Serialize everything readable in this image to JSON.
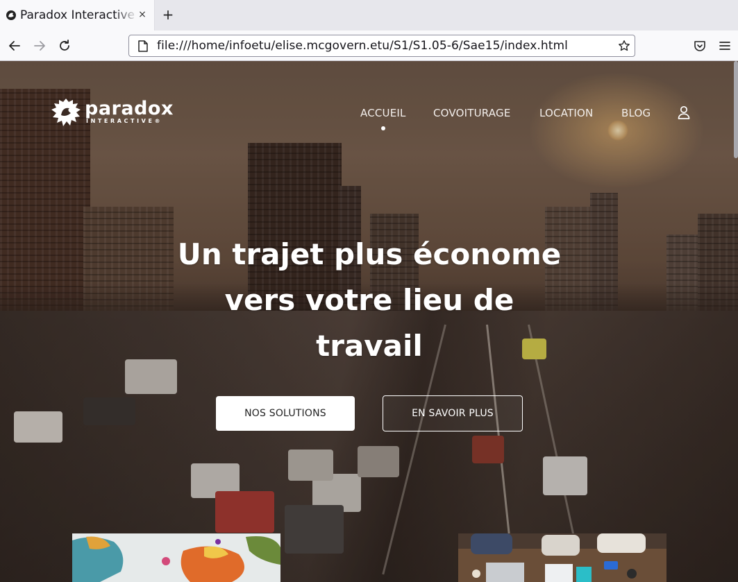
{
  "browser": {
    "tab_title": "Paradox Interactive",
    "tab_close_label": "×",
    "new_tab_label": "+",
    "url": "file:///home/infoetu/elise.mcgovern.etu/S1/S1.05-6/Sae15/index.html",
    "icons": [
      "back-icon",
      "forward-icon",
      "reload-icon",
      "page-icon",
      "star-icon",
      "pocket-icon",
      "menu-icon"
    ]
  },
  "site": {
    "logo": {
      "word": "paradox",
      "sub": "INTERACTIVE®"
    },
    "menu": [
      {
        "label": "ACCUEIL",
        "active": true
      },
      {
        "label": "COVOITURAGE",
        "active": false
      },
      {
        "label": "LOCATION",
        "active": false
      },
      {
        "label": "BLOG",
        "active": false
      }
    ],
    "hero": {
      "title_lines": [
        "Un trajet plus économe",
        "vers votre lieu de",
        "travail"
      ],
      "primary_button": "NOS SOLUTIONS",
      "secondary_button": "EN SAVOIR PLUS"
    },
    "colors": {
      "text": "#ffffff",
      "primary_button_bg": "#ffffff",
      "primary_button_text": "#222222"
    }
  }
}
